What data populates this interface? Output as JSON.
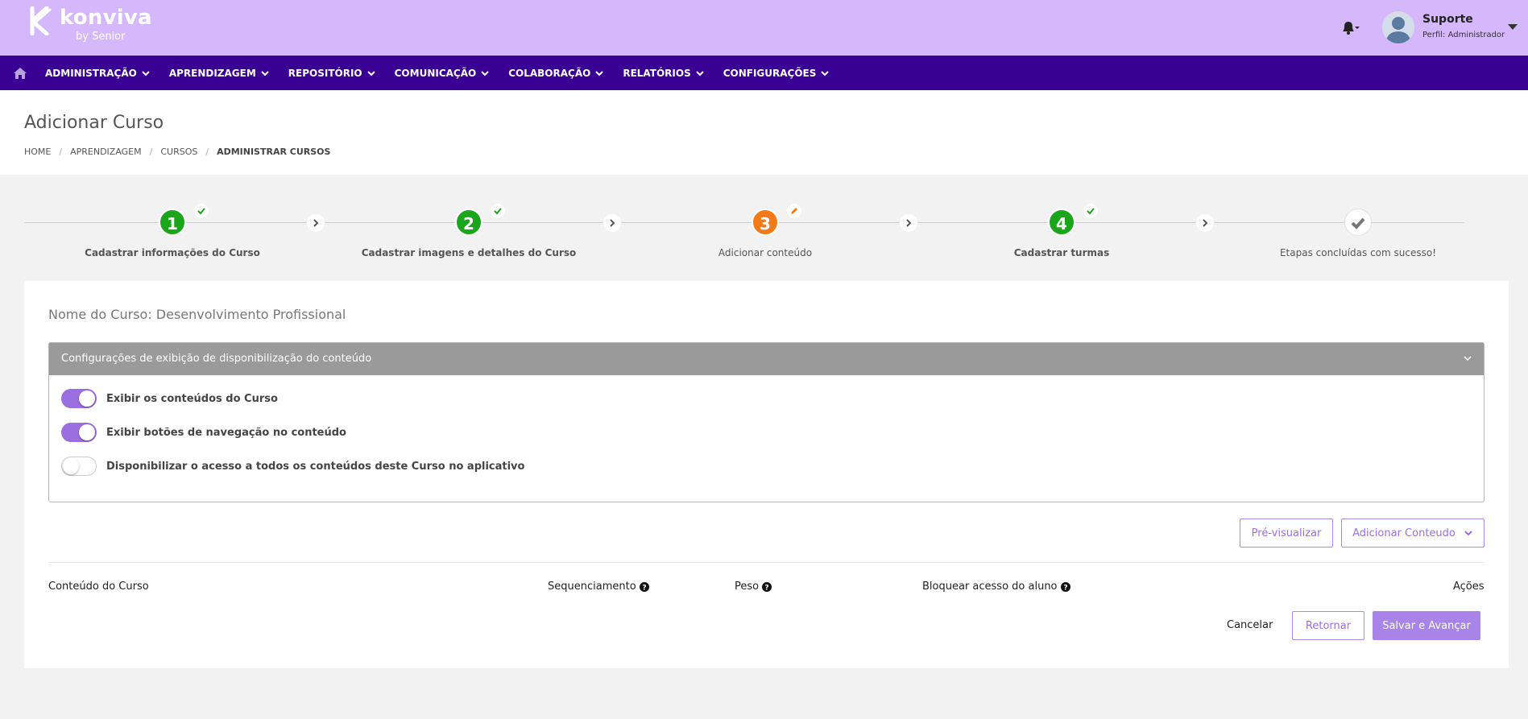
{
  "brand": {
    "name": "konviva",
    "byline": "by Senior"
  },
  "user": {
    "name": "Suporte",
    "profile": "Perfil: Administrador"
  },
  "nav": {
    "items": [
      {
        "label": "ADMINISTRAÇÃO"
      },
      {
        "label": "APRENDIZAGEM"
      },
      {
        "label": "REPOSITÓRIO"
      },
      {
        "label": "COMUNICAÇÃO"
      },
      {
        "label": "COLABORAÇÃO"
      },
      {
        "label": "RELATÓRIOS"
      },
      {
        "label": "CONFIGURAÇÕES"
      }
    ]
  },
  "page": {
    "title": "Adicionar Curso",
    "breadcrumb": [
      "HOME",
      "APRENDIZAGEM",
      "CURSOS",
      "ADMINISTRAR CURSOS"
    ]
  },
  "steps": [
    {
      "number": "1",
      "label": "Cadastrar informações do Curso",
      "state": "done",
      "color": "#1aa51a"
    },
    {
      "number": "2",
      "label": "Cadastrar imagens e detalhes do Curso",
      "state": "done",
      "color": "#1aa51a"
    },
    {
      "number": "3",
      "label": "Adicionar conteúdo",
      "state": "editing",
      "color": "#f47a17"
    },
    {
      "number": "4",
      "label": "Cadastrar turmas",
      "state": "done",
      "color": "#1aa51a"
    },
    {
      "number": "",
      "label": "Etapas concluídas com sucesso!",
      "state": "final",
      "color": "#ffffff"
    }
  ],
  "course": {
    "name_line": "Nome do Curso: Desenvolvimento Profissional"
  },
  "panel": {
    "title": "Configurações de exibição de disponibilização do conteúdo",
    "toggles": [
      {
        "label": "Exibir os conteúdos do Curso",
        "on": true
      },
      {
        "label": "Exibir botões de navegação no conteúdo",
        "on": true
      },
      {
        "label": "Disponibilizar o acesso a todos os conteúdos deste Curso no aplicativo",
        "on": false
      }
    ]
  },
  "actions": {
    "preview": "Pré-visualizar",
    "add_content": "Adicionar Conteudo"
  },
  "table": {
    "columns": [
      "Conteúdo do Curso",
      "Sequenciamento",
      "Peso",
      "Bloquear acesso do aluno",
      "Ações"
    ]
  },
  "footer": {
    "cancel": "Cancelar",
    "back": "Retornar",
    "save": "Salvar e Avançar"
  },
  "colors": {
    "topbar": "#d5b8fb",
    "nav": "#3a0094",
    "accent": "#9b6fe0",
    "done": "#1aa51a",
    "editing": "#f47a17"
  }
}
